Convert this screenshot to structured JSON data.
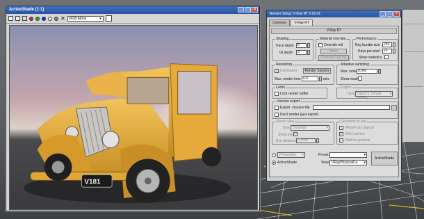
{
  "activeshade": {
    "title": "ActiveShade (1:1)",
    "channel": "RGB Alpha",
    "plate": "V181"
  },
  "render_setup": {
    "title": "Render Setup: V-Ray RT 2.00.01",
    "tabs": [
      "Common",
      "V-Ray RT"
    ],
    "rollout": "V-Ray RT",
    "shading": {
      "title": "Shading",
      "trace_depth_label": "Trace depth",
      "trace_depth": "5",
      "gi_depth_label": "GI depth",
      "gi_depth": "3"
    },
    "material_override": {
      "title": "Material override",
      "override_label": "Override mtl",
      "none_label": "None",
      "override_full_label": "Override Full mtl"
    },
    "performance": {
      "title": "Performance",
      "ray_bundle_label": "Ray bundle size",
      "ray_bundle": "256",
      "rays_per_pixel_label": "Rays per pixel",
      "rays_per_pixel": "16",
      "show_stats_label": "Show statistics"
    },
    "rendering": {
      "title": "Rendering",
      "distributed_label": "Distributed",
      "render_servers_label": "Render Servers",
      "max_render_time_label": "Max. render time",
      "max_render_time": "0.0",
      "min_label": "min."
    },
    "adaptive": {
      "title": "Adaptive sampling",
      "max_noise_label": "Max. noise",
      "max_noise": "0.001",
      "show_mask_label": "Show mask"
    },
    "locks": {
      "title": "Locks",
      "lock_buffer_label": "Lock render buffer"
    },
    "engine": {
      "title": "Engine",
      "type_label": "Type",
      "type_value": "OpenCL (single kernel)"
    },
    "vrscene": {
      "title": ".vrscene export",
      "export_label": "Export .vrscene file",
      "dont_render_label": "Don't render (just export)"
    },
    "stereo": {
      "title": "Stereo view",
      "type_label": "Type",
      "type_value": "Disabled",
      "swap_label": "Swap eyes",
      "eye_label": "Eye distance",
      "eye_value": "6.5mm"
    },
    "geometry": {
      "title": "Geometry to use",
      "proxy_label": "VRayProxy objects",
      "xref_label": "XRef scenes",
      "particle_label": "Particle systems"
    },
    "footer": {
      "mode_value": "Production",
      "activeshade_label": "ActiveShade",
      "preset_label": "Preset:",
      "preset_value": "",
      "view_label": "View:",
      "view_value": "VRayPhysicalCa",
      "activeshade_button": "ActiveShade"
    }
  },
  "colors": {
    "car_body": "#e0a734",
    "title_bar": "#2d5aa8",
    "panel": "#cfcfcf"
  }
}
